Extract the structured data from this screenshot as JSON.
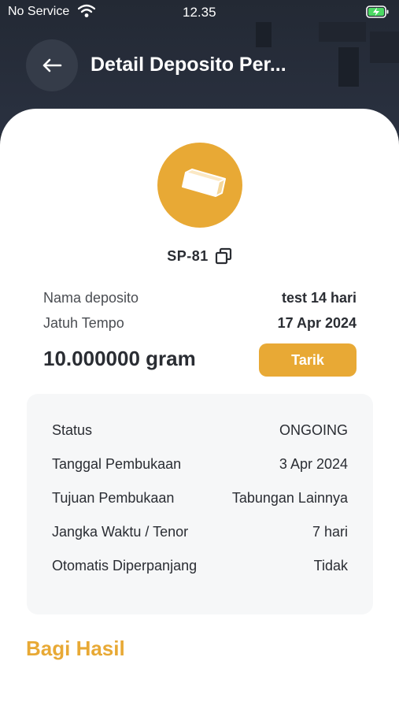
{
  "status_bar": {
    "carrier": "No Service",
    "time": "12.35"
  },
  "header": {
    "title": "Detail Deposito Per..."
  },
  "deposit": {
    "code": "SP-81",
    "fields": [
      {
        "label": "Nama deposito",
        "value": "test 14 hari"
      },
      {
        "label": "Jatuh Tempo",
        "value": "17 Apr 2024"
      }
    ],
    "amount": "10.000000 gram",
    "withdraw_label": "Tarik"
  },
  "details": [
    {
      "label": "Status",
      "value": "ONGOING"
    },
    {
      "label": "Tanggal Pembukaan",
      "value": "3 Apr 2024"
    },
    {
      "label": "Tujuan Pembukaan",
      "value": "Tabungan Lainnya"
    },
    {
      "label": "Jangka Waktu / Tenor",
      "value": "7 hari"
    },
    {
      "label": "Otomatis Diperpanjang",
      "value": "Tidak"
    }
  ],
  "section": {
    "title": "Bagi Hasil"
  },
  "colors": {
    "accent": "#e8a935",
    "header_bg": "#252b36"
  }
}
